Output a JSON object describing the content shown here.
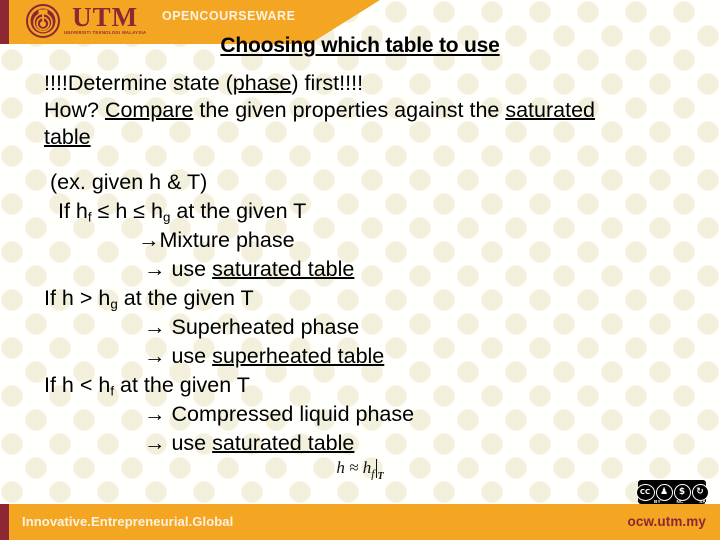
{
  "header": {
    "brand_initials": "UTM",
    "brand_subtitle": "UNIVERSITI TEKNOLOGI MALAYSIA",
    "ocw_label": "OPENCOURSEWARE",
    "accent_orange": "#f4a623",
    "accent_maroon": "#8c2733"
  },
  "title": {
    "text": "Choosing which table to use"
  },
  "intro": {
    "line1_a": "!!!!Determine state (",
    "line1_u": "phase",
    "line1_b": ") first!!!!",
    "line2_a": "How? ",
    "line2_u": "Compare",
    "line2_b": " the given properties against the ",
    "line2_u2": "saturated table"
  },
  "body": {
    "lines": [
      {
        "indent": 6,
        "segments": [
          {
            "text": "(ex. given h & T)",
            "underline": false,
            "sub": ""
          }
        ]
      },
      {
        "indent": 14,
        "segments": [
          {
            "text": "If h",
            "underline": false,
            "sub": "f"
          },
          {
            "text": " ≤ h ≤ h",
            "underline": false,
            "sub": "g"
          },
          {
            "text": " at the given T",
            "underline": false,
            "sub": ""
          }
        ]
      },
      {
        "indent": 94,
        "segments": [
          {
            "text": "→Mixture phase",
            "underline": false,
            "sub": ""
          }
        ]
      },
      {
        "indent": 100,
        "segments": [
          {
            "text": "→ use ",
            "underline": false,
            "sub": ""
          },
          {
            "text": "saturated table",
            "underline": true,
            "sub": ""
          }
        ]
      },
      {
        "indent": 0,
        "segments": [
          {
            "text": "If h > h",
            "underline": false,
            "sub": "g"
          },
          {
            "text": " at the given T",
            "underline": false,
            "sub": ""
          }
        ]
      },
      {
        "indent": 100,
        "segments": [
          {
            "text": "→ Superheated phase",
            "underline": false,
            "sub": ""
          }
        ]
      },
      {
        "indent": 100,
        "segments": [
          {
            "text": "→ use ",
            "underline": false,
            "sub": ""
          },
          {
            "text": "superheated table",
            "underline": true,
            "sub": ""
          }
        ]
      },
      {
        "indent": 0,
        "segments": [
          {
            "text": "If h < h",
            "underline": false,
            "sub": "f"
          },
          {
            "text": " at the given T",
            "underline": false,
            "sub": ""
          }
        ]
      },
      {
        "indent": 100,
        "segments": [
          {
            "text": "→ Compressed liquid phase",
            "underline": false,
            "sub": ""
          }
        ]
      },
      {
        "indent": 100,
        "segments": [
          {
            "text": "→ use ",
            "underline": false,
            "sub": ""
          },
          {
            "text": "saturated table",
            "underline": true,
            "sub": ""
          }
        ]
      }
    ]
  },
  "equation": {
    "lhs": "h",
    "relation": "≈",
    "rhs": "h",
    "rhs_sub": "f",
    "eval_at": "T"
  },
  "license": {
    "badge": "cc-by-nc-sa-icon",
    "cc_mark": "CC",
    "terms": [
      "BY",
      "NC",
      "SA"
    ]
  },
  "footer": {
    "tagline": "Innovative.Entrepreneurial.Global",
    "url": "ocw.utm.my"
  }
}
